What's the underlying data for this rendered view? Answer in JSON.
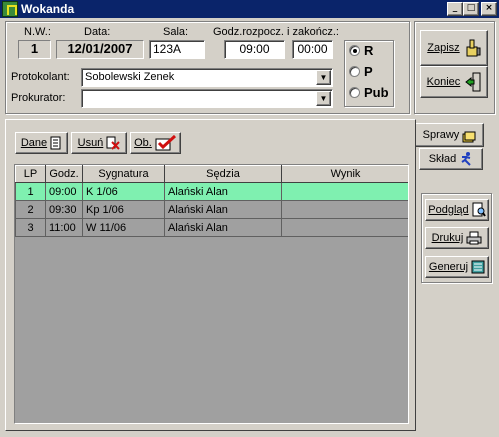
{
  "window": {
    "title": "Wokanda"
  },
  "header": {
    "nw_label": "N.W.:",
    "nw_value": "1",
    "date_label": "Data:",
    "date_value": "12/01/2007",
    "room_label": "Sala:",
    "room_value": "123A",
    "time_label": "Godz.rozpocz. i zakończ.:",
    "time_start": "09:00",
    "time_end": "00:00",
    "clerk_label": "Protokolant:",
    "clerk_value": "Sobolewski Zenek",
    "prosecutor_label": "Prokurator:",
    "prosecutor_value": ""
  },
  "radios": [
    {
      "label": "R",
      "checked": true
    },
    {
      "label": "P",
      "checked": false
    },
    {
      "label": "Pub",
      "checked": false
    }
  ],
  "actions": {
    "save": "Zapisz",
    "end": "Koniec"
  },
  "tabs": [
    {
      "label": "Sprawy",
      "active": true
    },
    {
      "label": "Skład",
      "active": false
    }
  ],
  "toolbar": {
    "data": "Dane",
    "delete": "Usuń",
    "ob": "Ob."
  },
  "grid": {
    "columns": [
      "LP",
      "Godz.",
      "Sygnatura",
      "Sędzia",
      "Wynik"
    ],
    "rows": [
      {
        "lp": "1",
        "time": "09:00",
        "sig": "K  1/06",
        "judge": "Alański Alan",
        "result": "",
        "selected": true
      },
      {
        "lp": "2",
        "time": "09:30",
        "sig": "Kp  1/06",
        "judge": "Alański Alan",
        "result": "",
        "selected": false
      },
      {
        "lp": "3",
        "time": "11:00",
        "sig": "W  11/06",
        "judge": "Alański Alan",
        "result": "",
        "selected": false
      }
    ]
  },
  "side": {
    "preview": "Podgląd",
    "print": "Drukuj",
    "generate": "Generuj"
  },
  "icons": [
    "app-icon",
    "minimize-icon",
    "maximize-icon",
    "close-icon",
    "thumbs-up-icon",
    "exit-door-icon",
    "data-icon",
    "delete-icon",
    "ob-check-icon",
    "folders-icon",
    "runner-icon",
    "preview-icon",
    "printer-icon",
    "generate-icon",
    "dropdown-arrow-icon"
  ]
}
